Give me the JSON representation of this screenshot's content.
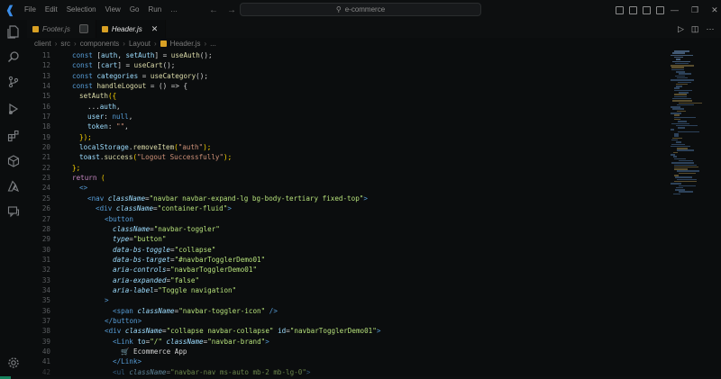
{
  "titlebar": {
    "menu": [
      "File",
      "Edit",
      "Selection",
      "View",
      "Go",
      "Run",
      "…"
    ],
    "search_text": "e-commerce"
  },
  "tabs": [
    {
      "label": "Footer.js",
      "active": false
    },
    {
      "label": "Header.js",
      "active": true
    }
  ],
  "breadcrumb": [
    "client",
    "src",
    "components",
    "Layout",
    "Header.js",
    "..."
  ],
  "code_lines": [
    {
      "n": "11",
      "indent": 2
    },
    {
      "n": "12",
      "indent": 2
    },
    {
      "n": "13",
      "indent": 2
    },
    {
      "n": "14",
      "indent": 2
    },
    {
      "n": "15",
      "indent": 2
    },
    {
      "n": "16",
      "indent": 4
    },
    {
      "n": "17",
      "indent": 6
    },
    {
      "n": "18",
      "indent": 6
    },
    {
      "n": "19",
      "indent": 6
    },
    {
      "n": "20",
      "indent": 4
    },
    {
      "n": "21",
      "indent": 4
    },
    {
      "n": "22",
      "indent": 4
    },
    {
      "n": "23",
      "indent": 2
    },
    {
      "n": "24",
      "indent": 2
    },
    {
      "n": "25",
      "indent": 4
    },
    {
      "n": "26",
      "indent": 6
    },
    {
      "n": "27",
      "indent": 8
    },
    {
      "n": "28",
      "indent": 10
    },
    {
      "n": "29",
      "indent": 12
    },
    {
      "n": "30",
      "indent": 12
    },
    {
      "n": "31",
      "indent": 12
    },
    {
      "n": "32",
      "indent": 12
    },
    {
      "n": "33",
      "indent": 12
    },
    {
      "n": "34",
      "indent": 12
    },
    {
      "n": "35",
      "indent": 12
    },
    {
      "n": "36",
      "indent": 10
    },
    {
      "n": "37",
      "indent": 12
    },
    {
      "n": "38",
      "indent": 10
    },
    {
      "n": "39",
      "indent": 10
    },
    {
      "n": "40",
      "indent": 12
    },
    {
      "n": "41",
      "indent": 14
    },
    {
      "n": "42",
      "indent": 12
    },
    {
      "n": "43",
      "indent": 12
    }
  ],
  "code_tokens": {
    "l11": [
      "const",
      " [",
      "auth",
      ", ",
      "setAuth",
      "] = ",
      "useAuth",
      "();"
    ],
    "l12": [
      "const",
      " [",
      "cart",
      "] = ",
      "useCart",
      "();"
    ],
    "l13": [
      "const",
      " ",
      "categories",
      " = ",
      "useCategory",
      "();"
    ],
    "l14": [
      "const",
      " ",
      "handleLogout",
      " = () => {"
    ],
    "l15": [
      "setAuth",
      "({"
    ],
    "l16": [
      "...",
      "auth",
      ","
    ],
    "l17": [
      "user",
      ": ",
      "null",
      ","
    ],
    "l18": [
      "token",
      ": ",
      "\"\"",
      ","
    ],
    "l19": [
      "});"
    ],
    "l20": [
      "localStorage",
      ".",
      "removeItem",
      "(",
      "\"auth\"",
      ");"
    ],
    "l21": [
      "toast",
      ".",
      "success",
      "(",
      "\"Logout Successfully\"",
      ");"
    ],
    "l22": [
      "};"
    ],
    "l23": [
      "return",
      " ("
    ],
    "l24": [
      "<>"
    ],
    "l25": [
      "<",
      "nav",
      " ",
      "className",
      "=",
      "\"navbar navbar-expand-lg bg-body-tertiary fixed-top\"",
      ">"
    ],
    "l26": [
      "<",
      "div",
      " ",
      "className",
      "=",
      "\"container-fluid\"",
      ">"
    ],
    "l27": [
      "<",
      "button"
    ],
    "l28": [
      "className",
      "=",
      "\"navbar-toggler\""
    ],
    "l29": [
      "type",
      "=",
      "\"button\""
    ],
    "l30": [
      "data-bs-toggle",
      "=",
      "\"collapse\""
    ],
    "l31": [
      "data-bs-target",
      "=",
      "\"#navbarTogglerDemo01\""
    ],
    "l32": [
      "aria-controls",
      "=",
      "\"navbarTogglerDemo01\""
    ],
    "l33": [
      "aria-expanded",
      "=",
      "\"false\""
    ],
    "l34": [
      "aria-label",
      "=",
      "\"Toggle navigation\""
    ],
    "l35": [
      ">"
    ],
    "l36": [
      "<",
      "span",
      " ",
      "className",
      "=",
      "\"navbar-toggler-icon\"",
      " />"
    ],
    "l37": [
      "</",
      "button",
      ">"
    ],
    "l38": [
      "<",
      "div",
      " ",
      "className",
      "=",
      "\"collapse navbar-collapse\"",
      " ",
      "id",
      "=",
      "\"navbarTogglerDemo01\"",
      ">"
    ],
    "l39": [
      "<",
      "Link",
      " ",
      "to",
      "=",
      "\"/\"",
      " ",
      "className",
      "=",
      "\"navbar-brand\"",
      ">"
    ],
    "l40": [
      "🛒",
      " Ecommerce App"
    ],
    "l41": [
      "</",
      "Link",
      ">"
    ],
    "l42": [
      "<",
      "ul",
      " ",
      "className",
      "=",
      "\"navbar-nav ms-auto mb-2 mb-lg-0\"",
      ">"
    ]
  },
  "colors": {
    "keyword": "#569cd6",
    "control": "#c586c0",
    "variable": "#9cdcfe",
    "function": "#dcdcaa",
    "string": "#ce9178",
    "jsx_string": "#b5e07a",
    "js_badge": "#d8a024",
    "accent_blue": "#3b8eea"
  },
  "icons": {
    "activity": [
      "files-icon",
      "search-icon",
      "source-control-icon",
      "run-debug-icon",
      "extensions-icon",
      "remote-explorer-icon",
      "azure-icon",
      "chat-icon",
      "settings-gear-icon"
    ]
  }
}
